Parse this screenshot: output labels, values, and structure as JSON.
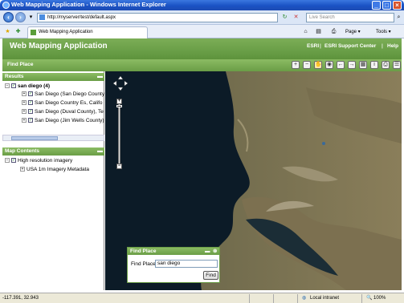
{
  "window": {
    "title": "Web Mapping Application - Windows Internet Explorer"
  },
  "address": {
    "url": "http://myserver/test/default.aspx",
    "search_placeholder": "Live Search"
  },
  "tab": {
    "label": "Web Mapping Application"
  },
  "browser_toolbar": {
    "page_label": "Page",
    "tools_label": "Tools"
  },
  "app": {
    "title": "Web Mapping Application",
    "links": [
      "ESRI",
      "ESRI Support Center",
      "Help"
    ],
    "toolbar_title": "Find Place"
  },
  "results": {
    "title": "Results",
    "root": "san diego (4)",
    "items": [
      "San Diego (San Diego County",
      "San Diego Country Es, Califo",
      "San Diego (Duval County), Te",
      "San Diego (Jim Wells County)"
    ]
  },
  "map_contents": {
    "title": "Map Contents",
    "layer": "High resolution imagery",
    "sublayer": "USA 1m Imagery Metadata"
  },
  "find_dialog": {
    "title": "Find Place",
    "label": "Find Place",
    "value": "san diego",
    "button": "Find"
  },
  "status": {
    "coords": "-117.391, 32.943",
    "zone": "Local intranet",
    "zoom": "100%"
  },
  "colors": {
    "header_green": "#6a9d46",
    "ie_blue": "#1a52c4"
  }
}
